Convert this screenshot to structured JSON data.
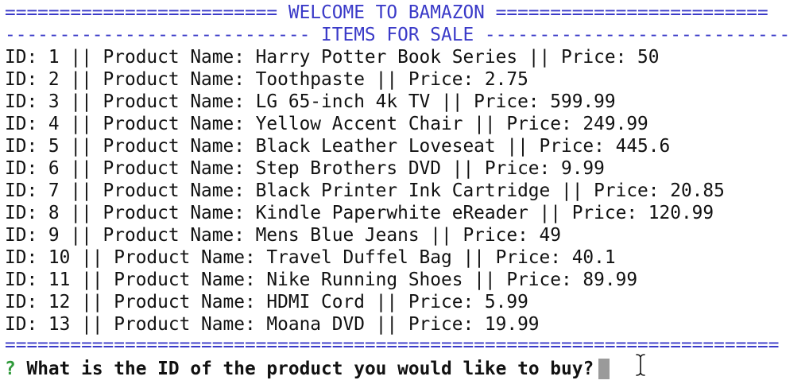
{
  "header": {
    "welcome_line": "========================= WELCOME TO BAMAZON =========================",
    "section_line": "---------------------------- ITEMS FOR SALE ----------------------------",
    "bottom_rule": "======================================================================="
  },
  "items": [
    {
      "text": "ID: 1 || Product Name: Harry Potter Book Series || Price: 50"
    },
    {
      "text": "ID: 2 || Product Name: Toothpaste || Price: 2.75"
    },
    {
      "text": "ID: 3 || Product Name: LG 65-inch 4k TV || Price: 599.99"
    },
    {
      "text": "ID: 4 || Product Name: Yellow Accent Chair || Price: 249.99"
    },
    {
      "text": "ID: 5 || Product Name: Black Leather Loveseat || Price: 445.6"
    },
    {
      "text": "ID: 6 || Product Name: Step Brothers DVD || Price: 9.99"
    },
    {
      "text": "ID: 7 || Product Name: Black Printer Ink Cartridge || Price: 20.85"
    },
    {
      "text": "ID: 8 || Product Name: Kindle Paperwhite eReader || Price: 120.99"
    },
    {
      "text": "ID: 9 || Product Name: Mens Blue Jeans || Price: 49"
    },
    {
      "text": "ID: 10 || Product Name: Travel Duffel Bag || Price: 40.1"
    },
    {
      "text": "ID: 11 || Product Name: Nike Running Shoes || Price: 89.99"
    },
    {
      "text": "ID: 12 || Product Name: HDMI Cord || Price: 5.99"
    },
    {
      "text": "ID: 13 || Product Name: Moana DVD || Price: 19.99"
    }
  ],
  "prompt": {
    "marker": "?",
    "question": "What is the ID of the product you would like to buy?",
    "input_value": ""
  },
  "colors": {
    "banner": "#3a3ac8",
    "question_mark": "#2f9a3a",
    "text": "#111111",
    "cursor": "#9a9a9a"
  },
  "icons": {
    "pointer": "text-ibeam-cursor-icon"
  }
}
